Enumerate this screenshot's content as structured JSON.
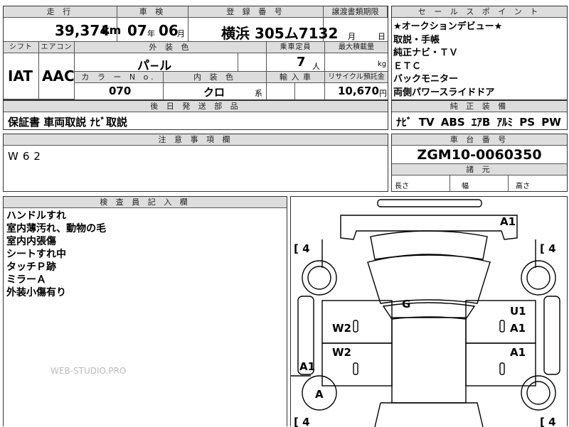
{
  "headers": {
    "mileage": "走 行",
    "inspection": "車 検",
    "registration": "登 録 番 号",
    "transfer_deadline": "譲渡書類期限",
    "shift": "シフト",
    "aircon": "エアコン",
    "exterior_color": "外 装 色",
    "capacity": "乗車定員",
    "max_load": "最大積載量",
    "color_no": "カ ラ ー N o.",
    "interior_color": "内 装 色",
    "import": "輸 入 車",
    "recycle": "リサイクル預託金",
    "sales_points": "セ ー ル ス ポ イ ン ト",
    "equipment": "純 正 装 備",
    "later_parts": "後 日 発 送 部 品",
    "notes": "注 意 事 項 欄",
    "chassis": "車 台 番 号",
    "dimensions": "諸 元",
    "inspector": "検 査 員 記 入 欄"
  },
  "values": {
    "mileage": "39,374",
    "mileage_unit": "km",
    "inspection_year": "07",
    "year_unit": "年",
    "inspection_month": "06",
    "month_unit": "月",
    "registration": "横浜 305ム7132",
    "deadline_month": "月",
    "deadline_day": "日",
    "shift": "IAT",
    "aircon": "AAC",
    "exterior_color": "パ−ル",
    "capacity": "7",
    "capacity_unit": "人",
    "load_unit": "kg",
    "color_no": "070",
    "interior_color": "クロ",
    "interior_suffix": "系",
    "recycle": "10,670",
    "recycle_unit": "円",
    "later_parts": "保証書 車両取説 ﾅﾋﾞ取説",
    "notes": "W62",
    "chassis": "ZGM10-0060350",
    "length_label": "長さ",
    "width_label": "幅",
    "height_label": "高さ"
  },
  "sales_points": [
    "★オークションデビュー★",
    "取説・手帳",
    "純正ナビ・ＴＶ",
    "ＥＴＣ",
    "バックモニター",
    "両側パワースライドドア"
  ],
  "equipment": "ﾅﾋﾞ TV ABS ｴｱB ｱﾙﾐ PS PW",
  "inspector_notes": [
    "ハンドルすれ",
    "室内薄汚れ、動物の毛",
    "室内内張傷",
    "シートすれ中",
    "タッチＰ跡",
    "ミラーＡ",
    "外装小傷有り"
  ],
  "watermark": "WEB-STUDIO.PRO",
  "diagram_marks": {
    "front_bumper": "A1",
    "hood": "G",
    "fl_door_upper": "W2",
    "fl_door_lower": "W2",
    "fr_door_upper": "U1",
    "fr_door_upper2": "A1",
    "fr_door_lower": "A1",
    "left_side_rear": "A1",
    "rear_left_wheel": "A",
    "tire_fl": "4",
    "tire_fr": "4",
    "tire_rl": "4",
    "tire_rr": "4"
  }
}
